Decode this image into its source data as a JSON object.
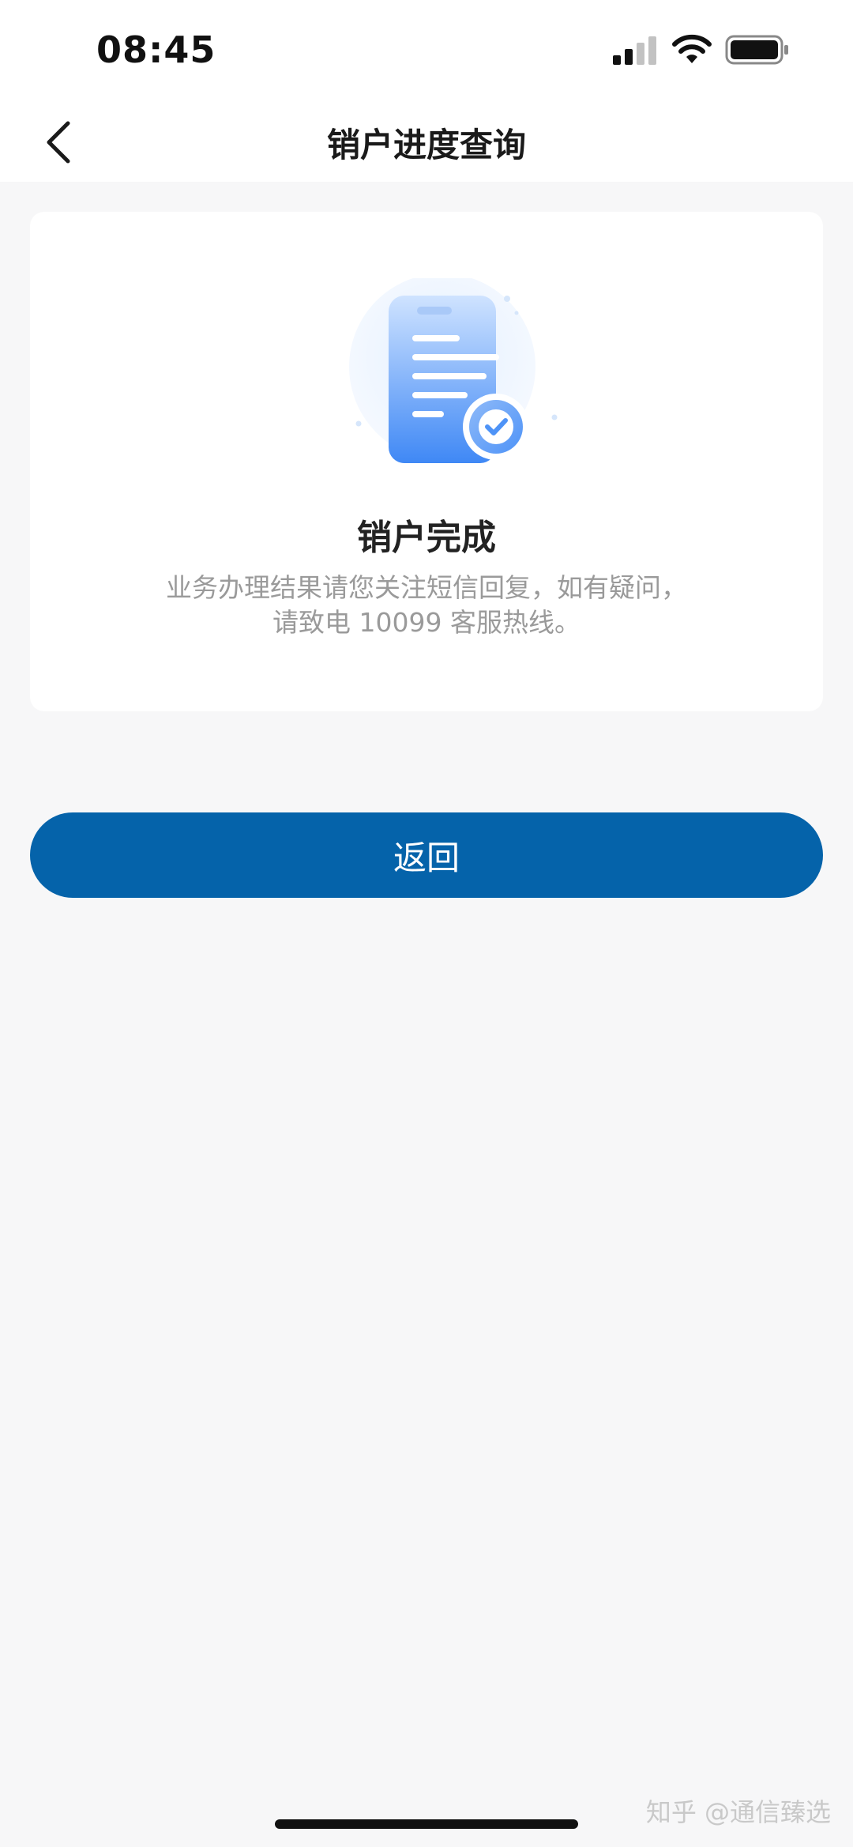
{
  "status_bar": {
    "time": "08:45",
    "icons": [
      "signal-icon",
      "wifi-icon",
      "battery-icon"
    ]
  },
  "nav": {
    "back_icon": "chevron-left-icon",
    "title": "销户进度查询"
  },
  "result": {
    "illustration_icon": "document-check-icon",
    "title": "销户完成",
    "description_line1": "业务办理结果请您关注短信回复，如有疑问，",
    "description_line2": "请致电 10099 客服热线。"
  },
  "actions": {
    "return_label": "返回"
  },
  "watermark": "知乎 @通信臻选",
  "colors": {
    "primary": "#0563aa",
    "background": "#f7f7f8",
    "card": "#ffffff",
    "text_secondary": "#9a9a9a",
    "illustration_blue": "#4e93f7"
  }
}
